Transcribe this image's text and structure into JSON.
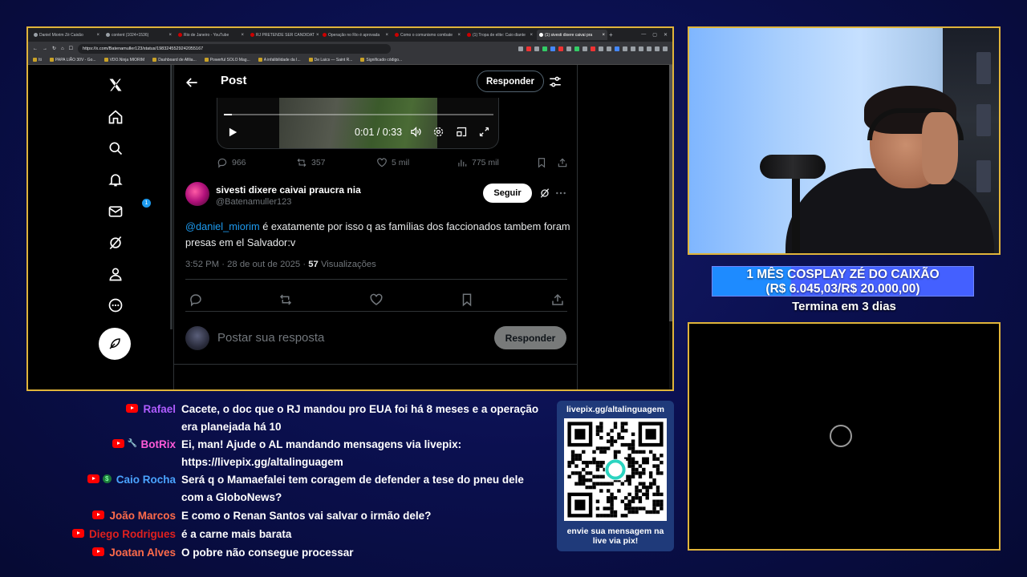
{
  "browser": {
    "tabs": [
      {
        "label": "Daniel Miorim Zé Caixão",
        "icon": "globe-icon",
        "active": false
      },
      {
        "label": "content (1024×1536)",
        "icon": "globe-icon",
        "active": false
      },
      {
        "label": "Rio de Janeiro - YouTube",
        "icon": "youtube-icon",
        "active": false
      },
      {
        "label": "RJ PRETENDE SER CANDIDAT",
        "icon": "youtube-icon",
        "active": false
      },
      {
        "label": "Operação no Rio é aprovada",
        "icon": "youtube-icon",
        "active": false
      },
      {
        "label": "Como o comunismo combate",
        "icon": "youtube-icon",
        "active": false
      },
      {
        "label": "(1) Tropa de elite: Caio diante",
        "icon": "youtube-icon",
        "active": false
      },
      {
        "label": "(1) sivesti dixere caivai pra",
        "icon": "x-icon",
        "active": true
      }
    ],
    "new_tab": "+",
    "window_controls": [
      "—",
      "▢",
      "✕"
    ],
    "url": "https://x.com/Batenamuller123/status/1983245529242055167",
    "bookmarks": [
      "Iti",
      "PAPA LIÃO 30V - Go...",
      "VDO.Ninja MIORIM",
      "Dashboard de Afilia...",
      "Powerful SOLO Mag...",
      "A infalibilidade da I...",
      "De Laics — Saint R...",
      "Significado código..."
    ]
  },
  "x": {
    "nav_icons": [
      "x-logo-icon",
      "home-icon",
      "search-icon",
      "bell-icon",
      "mail-icon",
      "grok-icon",
      "profile-icon",
      "more-circle-icon"
    ],
    "notification_count": "1",
    "header": {
      "title": "Post",
      "reply_button": "Responder"
    },
    "video": {
      "time": "0:01 / 0:33",
      "progress_fraction": 0.03
    },
    "stats": {
      "replies": "966",
      "reposts": "357",
      "likes": "5 mil",
      "views": "775 mil"
    },
    "reply": {
      "display_name": "sivesti dixere caivai praucra nia",
      "handle": "@Batenamuller123",
      "follow_button": "Seguir",
      "mention": "@daniel_miorim",
      "text": " é exatamente por isso q as famílias dos faccionados tambem foram presas em el Salvador:v",
      "timestamp": "3:52 PM · 28 de out de 2025 · ",
      "views_count": "57",
      "views_label": " Visualizações"
    },
    "compose": {
      "placeholder": "Postar sua resposta",
      "button": "Responder"
    }
  },
  "overlay": {
    "goal_title": "1 MÊS COSPLAY ZÉ DO CAIXÃO",
    "goal_amount": "(R$ 6.045,03/R$ 20.000,00)",
    "goal_fraction": 0.302,
    "goal_ends": "Termina em 3 dias",
    "accent_color": "#e0b43a"
  },
  "chat": [
    {
      "name": "Rafael",
      "color": "#b05cff",
      "badges": [
        "youtube"
      ],
      "lines": [
        "Cacete, o doc que o RJ mandou pro EUA foi há 8 meses e a operação",
        "era planejada há 10"
      ]
    },
    {
      "name": "BotRix",
      "color": "#ff5ad8",
      "badges": [
        "youtube",
        "bot"
      ],
      "lines": [
        "Ei, man! Ajude o AL mandando mensagens via livepix:",
        "https://livepix.gg/altalinguagem"
      ]
    },
    {
      "name": "Caio Rocha",
      "color": "#4aa3ff",
      "badges": [
        "youtube",
        "money"
      ],
      "lines": [
        "Será q o Mamaefalei tem coragem de defender a tese do pneu dele",
        "com a GloboNews?"
      ]
    },
    {
      "name": "João Marcos",
      "color": "#ff6b4a",
      "badges": [
        "youtube"
      ],
      "lines": [
        "E como o Renan Santos vai salvar o irmão dele?"
      ]
    },
    {
      "name": "Diego Rodrigues",
      "color": "#e0201e",
      "badges": [
        "youtube"
      ],
      "lines": [
        "é a carne mais barata"
      ]
    },
    {
      "name": "Joatan Alves",
      "color": "#ff6b4a",
      "badges": [
        "youtube"
      ],
      "lines": [
        "O pobre não consegue processar"
      ]
    }
  ],
  "qr": {
    "url": "livepix.gg/altalinguagem",
    "caption_line1": "envie sua mensagem na",
    "caption_line2": "live via pix!"
  }
}
